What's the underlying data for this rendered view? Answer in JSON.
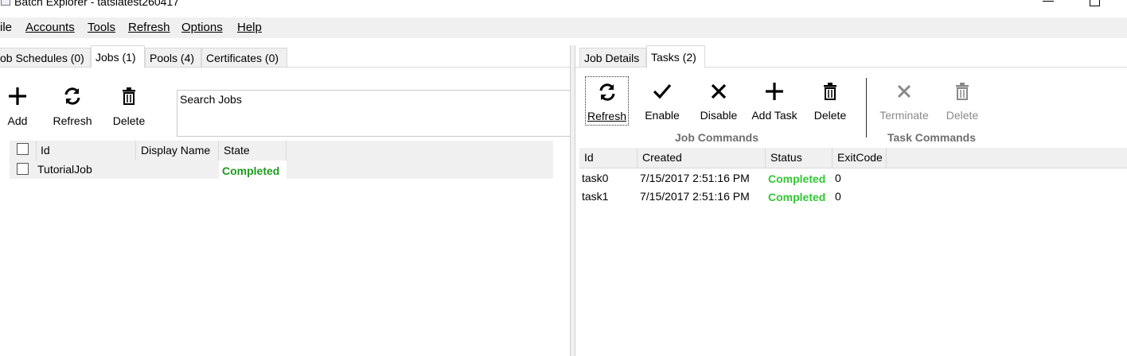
{
  "window": {
    "title": "Batch Explorer - tatslatest260417"
  },
  "menu": [
    {
      "label": "ile"
    },
    {
      "label": "Accounts"
    },
    {
      "label": "Tools"
    },
    {
      "label": "Refresh"
    },
    {
      "label": "Options"
    },
    {
      "label": "Help"
    }
  ],
  "left_tabs": [
    {
      "label": "ob Schedules (0)"
    },
    {
      "label": "Jobs (1)"
    },
    {
      "label": "Pools (4)"
    },
    {
      "label": "Certificates (0)"
    }
  ],
  "left_toolbar": {
    "add_label": "Add",
    "refresh_label": "Refresh",
    "delete_label": "Delete"
  },
  "search": {
    "value": "Search Jobs"
  },
  "jobs_grid": {
    "headers": {
      "id": "Id",
      "display_name": "Display Name",
      "state": "State"
    },
    "rows": [
      {
        "id": "TutorialJob",
        "display_name": "",
        "state": "Completed"
      }
    ]
  },
  "right_tabs": [
    {
      "label": "Job Details"
    },
    {
      "label": "Tasks (2)"
    }
  ],
  "right_toolbar": {
    "job_commands": {
      "group_label": "Job Commands",
      "refresh_label": "Refresh",
      "enable_label": "Enable",
      "disable_label": "Disable",
      "add_task_label": "Add Task",
      "delete_label": "Delete"
    },
    "task_commands": {
      "group_label": "Task Commands",
      "terminate_label": "Terminate",
      "delete_label": "Delete"
    }
  },
  "tasks_grid": {
    "headers": {
      "id": "Id",
      "created": "Created",
      "status": "Status",
      "exitcode": "ExitCode"
    },
    "rows": [
      {
        "id": "task0",
        "created": "7/15/2017 2:51:16 PM",
        "status": "Completed",
        "exitcode": "0"
      },
      {
        "id": "task1",
        "created": "7/15/2017 2:51:16 PM",
        "status": "Completed",
        "exitcode": "0"
      }
    ]
  },
  "colors": {
    "completed_dark": "#1e9b1e",
    "completed_bright": "#32c832",
    "disabled_text": "#8a8a8a",
    "chrome_bg": "#f0f0f0"
  },
  "icons": [
    "app-icon",
    "minimize-icon",
    "maximize-icon",
    "plus-icon",
    "refresh-icon",
    "trash-icon",
    "check-icon",
    "x-icon"
  ]
}
